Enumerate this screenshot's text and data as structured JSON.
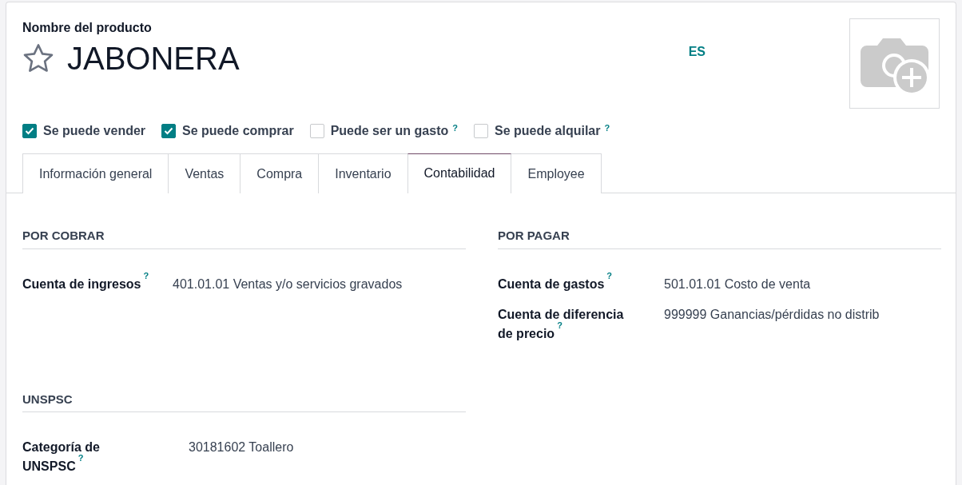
{
  "product": {
    "label": "Nombre del producto",
    "name": "JABONERA",
    "favorite": false,
    "language": "ES"
  },
  "options": [
    {
      "label": "Se puede vender",
      "checked": true
    },
    {
      "label": "Se puede comprar",
      "checked": true
    },
    {
      "label": "Puede ser un gasto",
      "checked": false,
      "help": "?"
    },
    {
      "label": "Se puede alquilar",
      "checked": false,
      "help": "?"
    }
  ],
  "tabs": [
    {
      "label": "Información general",
      "selected": false
    },
    {
      "label": "Ventas",
      "selected": false
    },
    {
      "label": "Compra",
      "selected": false
    },
    {
      "label": "Inventario",
      "selected": false
    },
    {
      "label": "Contabilidad",
      "selected": true
    },
    {
      "label": "Employee",
      "selected": false
    }
  ],
  "sections": [
    {
      "title": "POR COBRAR",
      "fields": [
        {
          "label": "Cuenta de ingresos",
          "help": "?",
          "value": "401.01.01 Ventas y/o servicios gravados"
        }
      ]
    },
    {
      "title": "POR PAGAR",
      "fields": [
        {
          "label": "Cuenta de gastos",
          "help": "?",
          "value": "501.01.01 Costo de venta"
        },
        {
          "label": "Cuenta de diferencia de precio",
          "help": "?",
          "value": "999999 Ganancias/pérdidas no distrib"
        }
      ]
    },
    {
      "title": "UNSPSC",
      "fields": [
        {
          "label": "Categoría de UNSPSC",
          "help": "?",
          "value": "30181602 Toallero"
        }
      ]
    }
  ]
}
